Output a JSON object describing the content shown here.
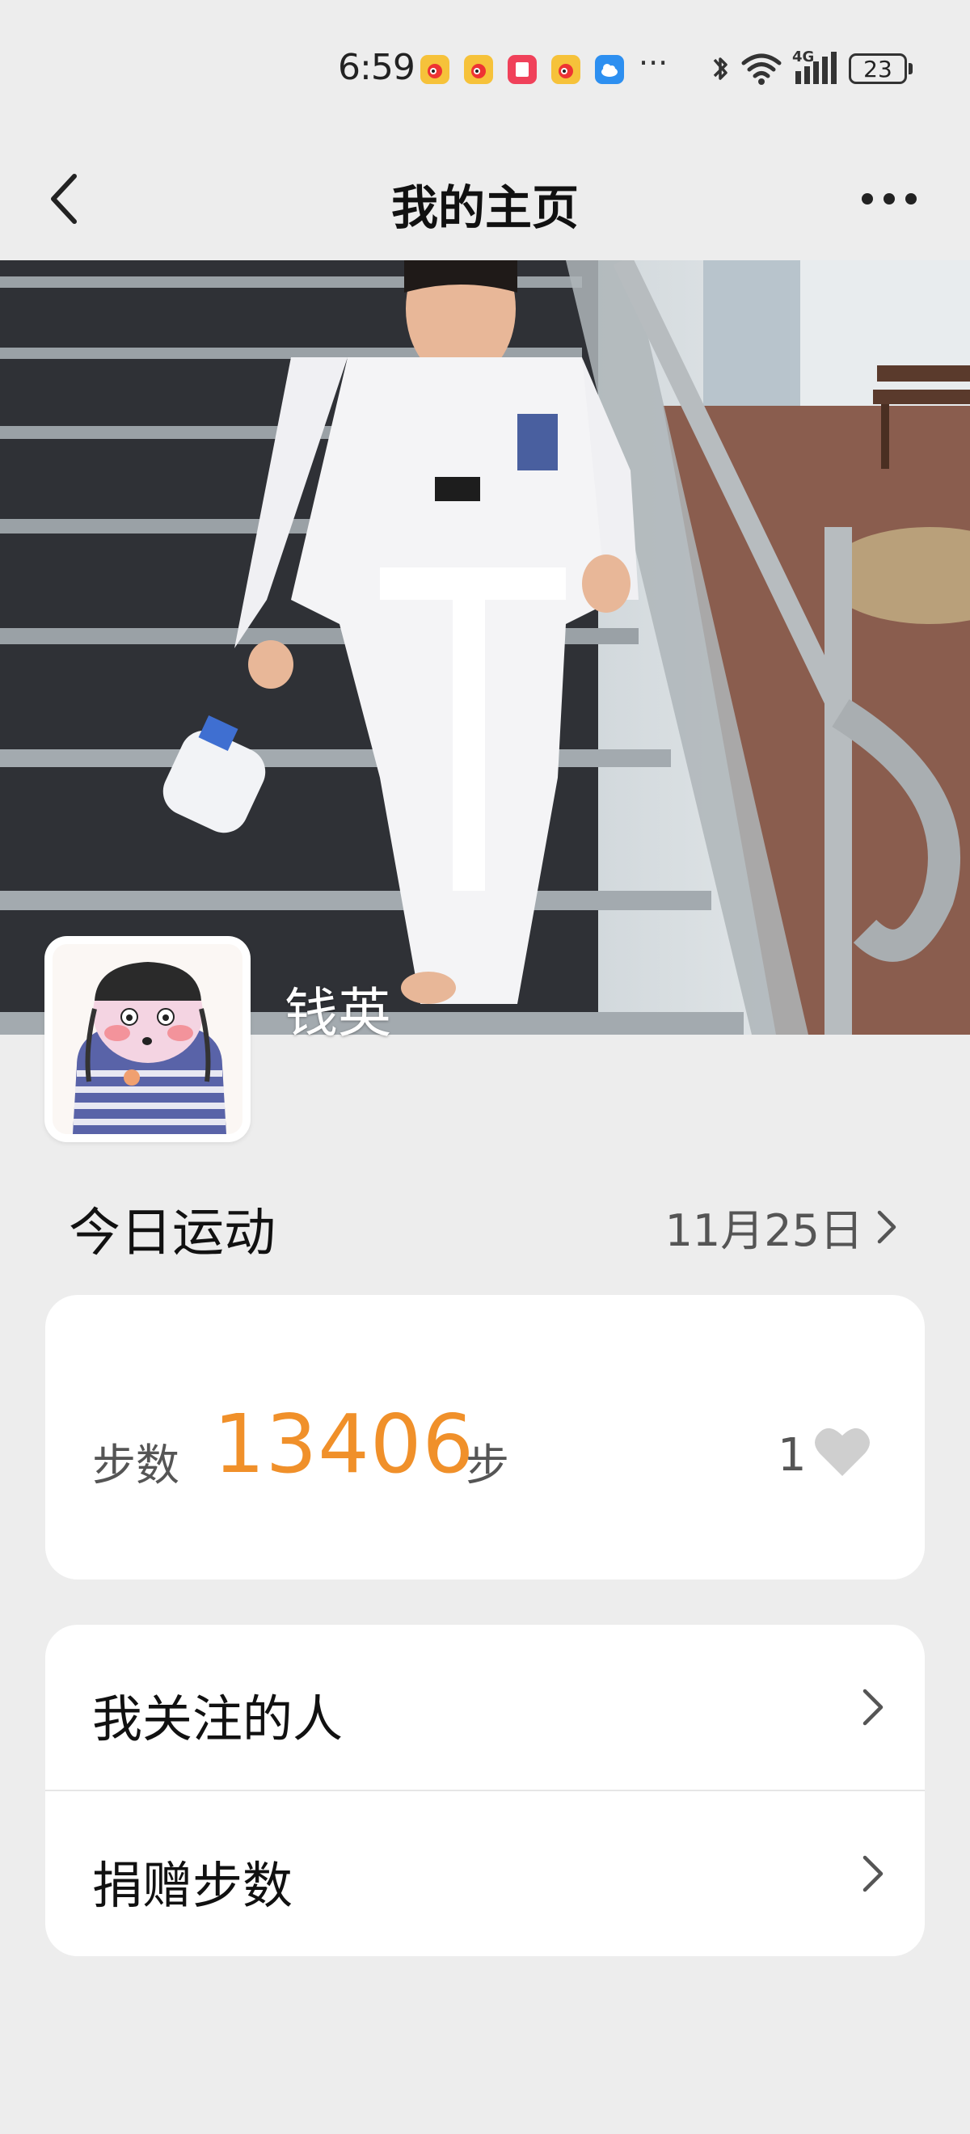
{
  "status_bar": {
    "time": "6:59",
    "more": "···",
    "network": "4G",
    "battery": "23"
  },
  "nav": {
    "title": "我的主页"
  },
  "profile": {
    "name": "钱英"
  },
  "today": {
    "title": "今日运动",
    "date": "11月25日"
  },
  "steps": {
    "label": "步数",
    "value": "13406",
    "unit": "步",
    "likes": "1",
    "accent_color": "#f0902a"
  },
  "menu": {
    "items": [
      {
        "label": "我关注的人"
      },
      {
        "label": "捐赠步数"
      }
    ]
  }
}
